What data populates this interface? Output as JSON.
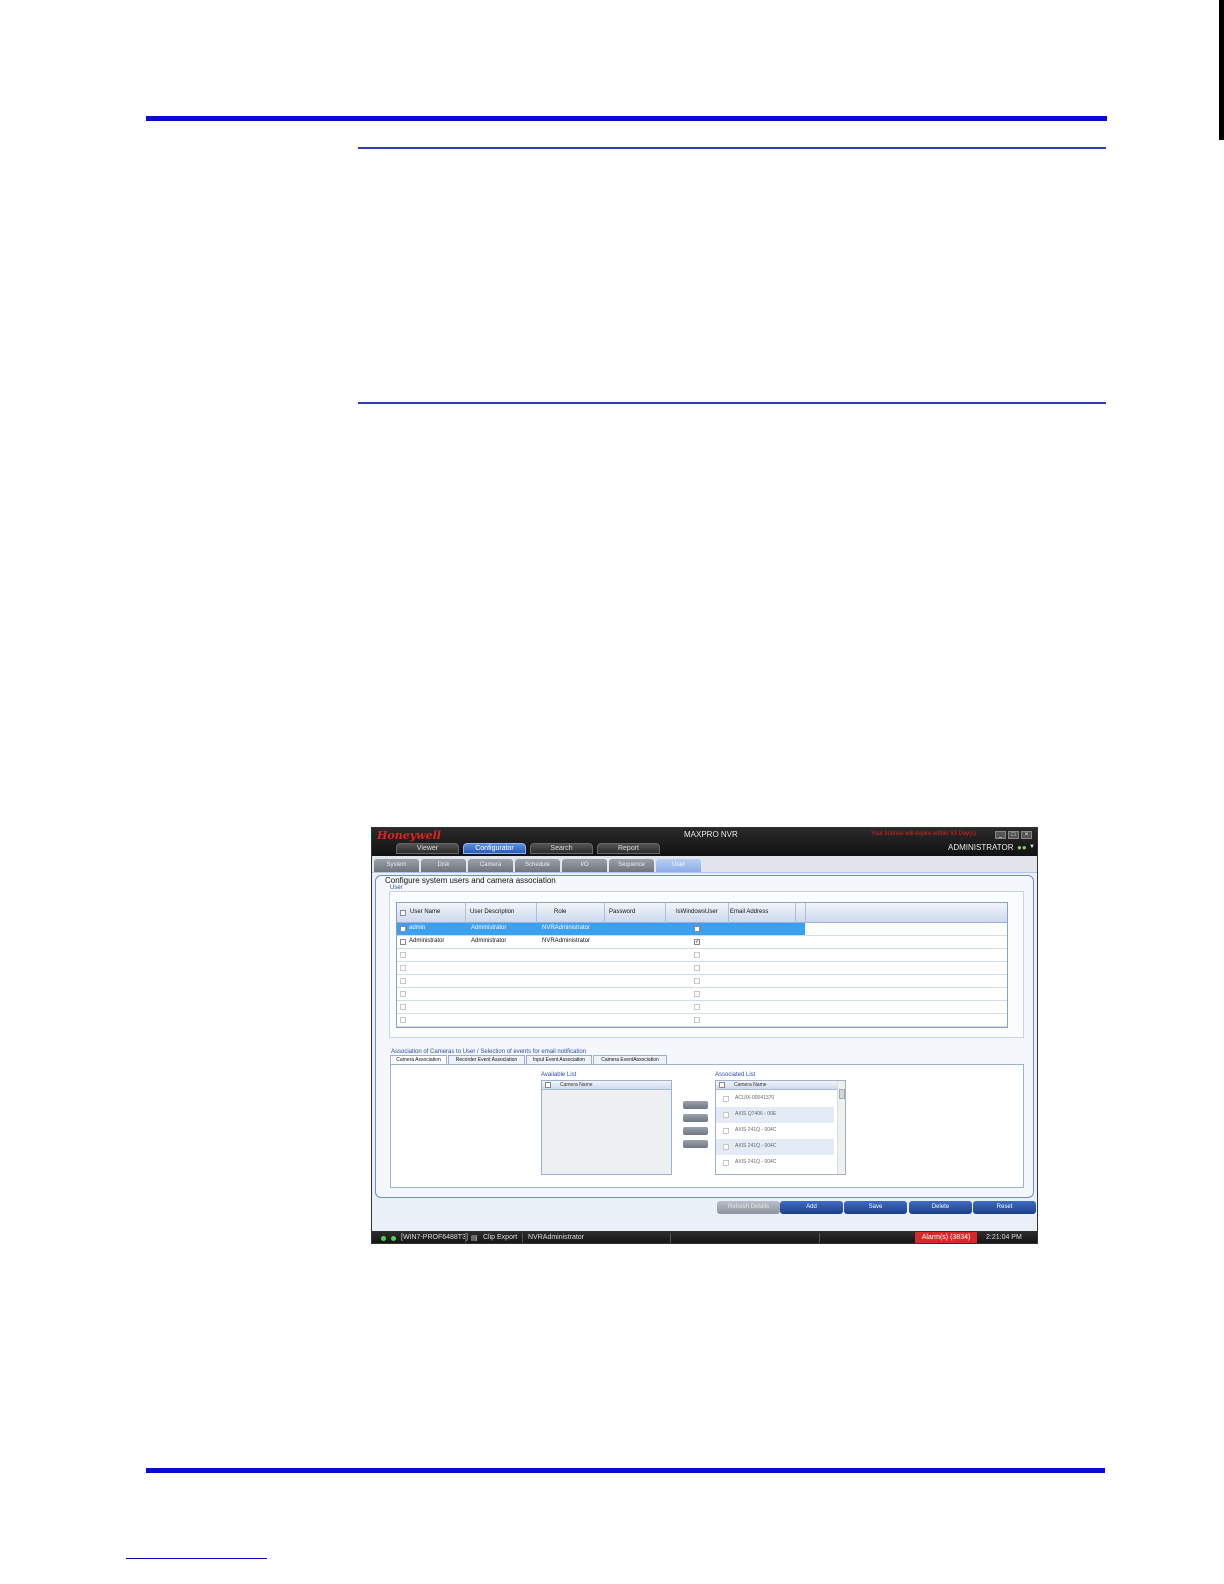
{
  "app": {
    "logo": "Honeywell",
    "title": "MAXPRO NVR",
    "license_notice": "Your license will expire within 53 Day(s)",
    "window_buttons": [
      "_",
      "□",
      "×"
    ],
    "current_user": "ADMINISTRATOR",
    "main_tabs": [
      {
        "label": "Viewer"
      },
      {
        "label": "Configurator"
      },
      {
        "label": "Search"
      },
      {
        "label": "Report"
      }
    ],
    "sub_tabs": [
      {
        "label": "System"
      },
      {
        "label": "Disk"
      },
      {
        "label": "Camera"
      },
      {
        "label": "Schedule"
      },
      {
        "label": "I/O"
      },
      {
        "label": "Sequence"
      },
      {
        "label": "User"
      }
    ],
    "panel_title": "Configure system users and camera association",
    "user_group_label": "User",
    "user_grid": {
      "columns": [
        "User Name",
        "User Description",
        "Role",
        "Password",
        "IsWindowsUser",
        "Email Address"
      ],
      "rows": [
        {
          "name": "admin",
          "description": "Administrator",
          "role": "NVRAdministrator",
          "password": "",
          "windows_user": false,
          "email": ""
        },
        {
          "name": "Administrator",
          "description": "Administrator",
          "role": "NVRAdministrator",
          "password": "",
          "windows_user": true,
          "email": ""
        }
      ]
    },
    "association_label": "Association of Cameras to User / Selection of events for email notification",
    "association_tabs": [
      {
        "label": "Camera Association"
      },
      {
        "label": "Recorder Event Association"
      },
      {
        "label": "Input Event Association"
      },
      {
        "label": "Camera EventAssociation"
      }
    ],
    "available_list": {
      "label": "Available List",
      "header": "Camera Name"
    },
    "associated_list": {
      "label": "Associated List",
      "header": "Camera Name",
      "items": [
        "ACUIX-00041370",
        "AXIS Q7406 - 00E",
        "AXIS 241Q - 004C",
        "AXIS 241Q - 004C",
        "AXIS 241Q - 004C"
      ]
    },
    "actions": [
      {
        "label": "Refresh Details"
      },
      {
        "label": "Add"
      },
      {
        "label": "Save"
      },
      {
        "label": "Delete"
      },
      {
        "label": "Reset"
      }
    ],
    "status": {
      "host": "[WIN7-PROF6488T3]",
      "clip_export": "Clip Export",
      "role": "NVRAdministrator",
      "alarm": "Alarm(s) (3834)",
      "time": "2:21:04 PM"
    }
  }
}
